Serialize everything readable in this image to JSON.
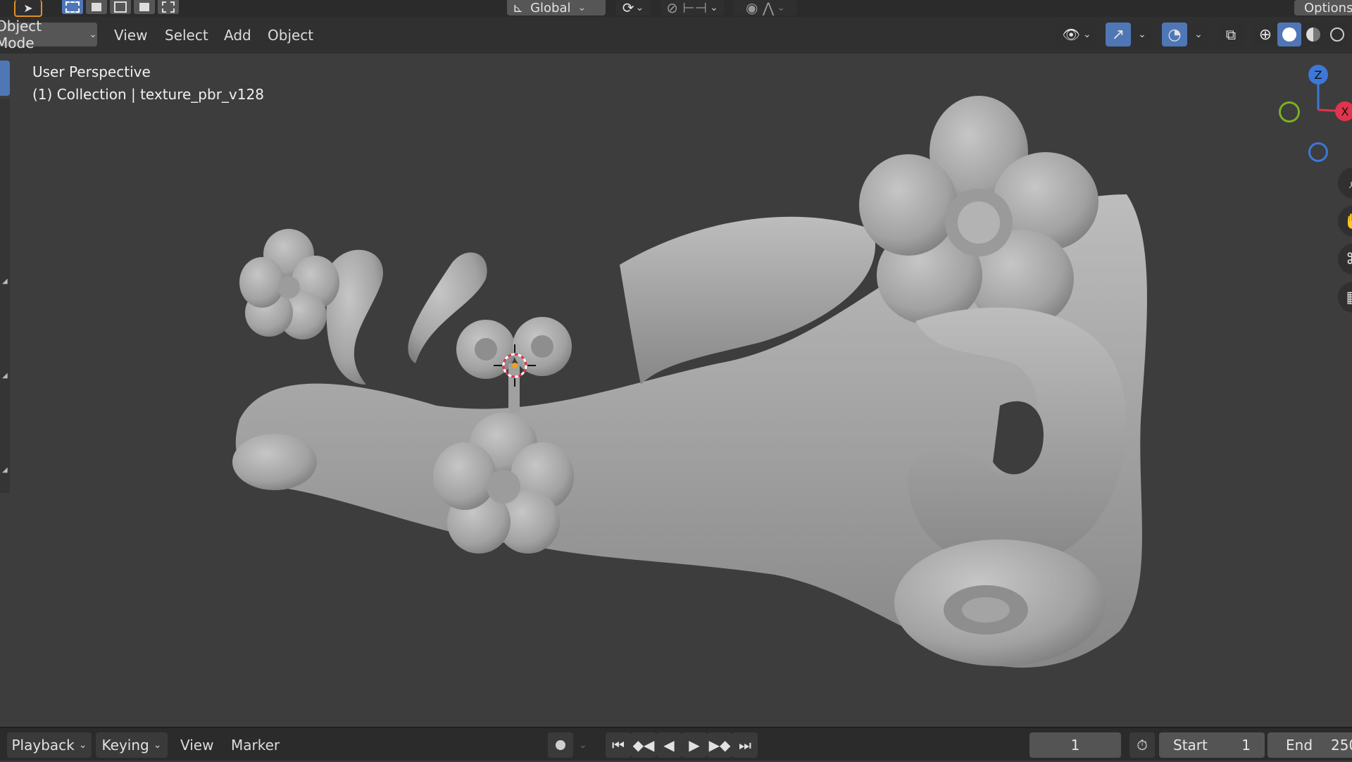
{
  "toolbar": {
    "orientation_label": "Global",
    "options_label": "Options"
  },
  "header": {
    "mode_label": "Object Mode",
    "menus": [
      "View",
      "Select",
      "Add",
      "Object"
    ]
  },
  "viewport": {
    "view_label": "User Perspective",
    "collection_label": "(1) Collection | texture_pbr_v128",
    "axis_z": "Z",
    "axis_x": "X"
  },
  "timeline": {
    "menus": [
      "Playback",
      "Keying",
      "View",
      "Marker"
    ],
    "current_frame": "1",
    "start_label": "Start",
    "start_value": "1",
    "end_label": "End",
    "end_value": "250"
  },
  "colors": {
    "background": "#3d3d3d",
    "accent_blue": "#4f77b6",
    "axis_z": "#3d78d8",
    "axis_x": "#e0344d",
    "axis_y": "#7ab023",
    "model": "#a8a8a8"
  },
  "icons": [
    "select-cursor-icon",
    "box-select-icon",
    "orientation-icon",
    "pivot-icon",
    "snap-icon",
    "proportional-edit-icon",
    "visibility-icon",
    "gizmo-icon",
    "overlay-icon",
    "xray-icon",
    "wireframe-shading-icon",
    "solid-shading-icon",
    "material-shading-icon",
    "rendered-shading-icon",
    "zoom-icon",
    "pan-icon",
    "camera-icon",
    "grid-icon",
    "record-icon",
    "jump-start-icon",
    "prev-keyframe-icon",
    "play-reverse-icon",
    "play-icon",
    "next-keyframe-icon",
    "jump-end-icon",
    "stopwatch-icon"
  ]
}
